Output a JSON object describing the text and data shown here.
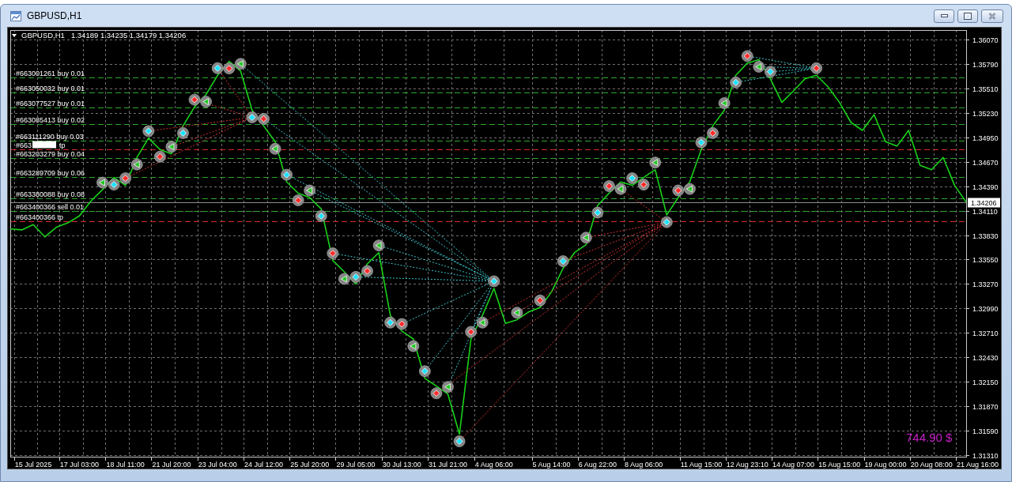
{
  "window": {
    "title": "GBPUSD,H1"
  },
  "chart": {
    "symbol": "GBPUSD,H1",
    "quote": "1.34189 1.34235 1.34179 1.34206",
    "profit": "744.90 $",
    "chart_data": {
      "type": "line",
      "grid": true,
      "categories": [
        null,
        null,
        "15 Jul 2025",
        null,
        null,
        null,
        "17 Jul 03:00",
        null,
        null,
        null,
        "18 Jul 11:00",
        null,
        null,
        null,
        "21 Jul 20:00",
        null,
        null,
        null,
        "23 Jul 04:00",
        null,
        null,
        null,
        "24 Jul 12:00",
        null,
        null,
        null,
        "25 Jul 20:00",
        null,
        null,
        null,
        "29 Jul 05:00",
        null,
        null,
        null,
        "30 Jul 13:00",
        null,
        null,
        null,
        "31 Jul 21:00",
        null,
        null,
        null,
        "4 Aug 06:00",
        null,
        null,
        null,
        null,
        "5 Aug 14:00",
        null,
        null,
        null,
        "6 Aug 22:00",
        null,
        null,
        null,
        "8 Aug 06:00",
        null,
        null,
        null,
        null,
        "11 Aug 15:00",
        null,
        null,
        null,
        "12 Aug 23:10",
        null,
        null,
        null,
        "14 Aug 07:00",
        null,
        null,
        null,
        "15 Aug 15:00",
        null,
        null,
        null,
        "19 Aug 00:00",
        null,
        null,
        null,
        "20 Aug 08:00",
        null,
        null,
        null,
        "21 Aug 16:00"
      ],
      "ylim": [
        1.31292,
        1.36179
      ],
      "yticks": [
        {
          "value": 1.3607,
          "label": "1.36070"
        },
        {
          "value": 1.3579,
          "label": "1.35790"
        },
        {
          "value": 1.3551,
          "label": "1.35510"
        },
        {
          "value": 1.3523,
          "label": "1.35230"
        },
        {
          "value": 1.3495,
          "label": "1.34950"
        },
        {
          "value": 1.3467,
          "label": "1.34670"
        },
        {
          "value": 1.3439,
          "label": "1.34390"
        },
        {
          "value": 1.3411,
          "label": "1.34110"
        },
        {
          "value": 1.3383,
          "label": "1.33830"
        },
        {
          "value": 1.3355,
          "label": "1.33550"
        },
        {
          "value": 1.3327,
          "label": "1.33270"
        },
        {
          "value": 1.3299,
          "label": "1.32990"
        },
        {
          "value": 1.3271,
          "label": "1.32710"
        },
        {
          "value": 1.3243,
          "label": "1.32430"
        },
        {
          "value": 1.3215,
          "label": "1.32150"
        },
        {
          "value": 1.3187,
          "label": "1.31870"
        },
        {
          "value": 1.3159,
          "label": "1.31590"
        },
        {
          "value": 1.3131,
          "label": "1.31310"
        }
      ],
      "series": [
        {
          "color": "#19d219",
          "values": [
            1.339,
            1.3389,
            1.3395,
            1.3381,
            1.3392,
            1.3397,
            1.3405,
            1.3422,
            1.3435,
            1.3449,
            1.344,
            1.3472,
            1.3494,
            1.3481,
            1.3476,
            1.3508,
            1.353,
            1.3544,
            1.3566,
            1.3582,
            1.3571,
            1.3526,
            1.3508,
            1.349,
            1.3444,
            1.3431,
            1.3426,
            1.3413,
            1.3354,
            1.3341,
            1.3327,
            1.335,
            1.3363,
            1.3291,
            1.3273,
            1.3264,
            1.3219,
            1.321,
            1.3201,
            1.3155,
            1.3264,
            1.3291,
            1.3322,
            1.3282,
            1.3286,
            1.3295,
            1.33,
            1.3318,
            1.3345,
            1.3363,
            1.3372,
            1.3417,
            1.3431,
            1.3444,
            1.344,
            1.3449,
            1.3458,
            1.3406,
            1.3426,
            1.3444,
            1.3481,
            1.3508,
            1.3526,
            1.3566,
            1.358,
            1.3584,
            1.3562,
            1.3535,
            1.3548,
            1.3562,
            1.3566,
            1.3553,
            1.3535,
            1.3512,
            1.3503,
            1.3521,
            1.349,
            1.3485,
            1.3503,
            1.3463,
            1.3458,
            1.3472,
            1.344,
            1.3421,
            null
          ]
        }
      ],
      "ref_lines": [
        {
          "axis": "y",
          "value": 1.3564,
          "color": "#2ca82c"
        },
        {
          "axis": "y",
          "value": 1.3546,
          "color": "#2ca82c"
        },
        {
          "axis": "y",
          "value": 1.3529,
          "color": "#2ca82c"
        },
        {
          "axis": "y",
          "value": 1.351,
          "color": "#2ca82c"
        },
        {
          "axis": "y",
          "value": 1.3491,
          "color": "#2ca82c"
        },
        {
          "axis": "y",
          "value": 1.3481,
          "color": "#d42a2a"
        },
        {
          "axis": "y",
          "value": 1.3471,
          "color": "#2ca82c"
        },
        {
          "axis": "y",
          "value": 1.345,
          "color": "#2ca82c"
        },
        {
          "axis": "y",
          "value": 1.3425,
          "color": "#2ca82c"
        },
        {
          "axis": "y",
          "value": 1.34206,
          "label": "1.34206",
          "color": "#8e8e8e"
        },
        {
          "axis": "y",
          "value": 1.3411,
          "color": "#2ca82c"
        },
        {
          "axis": "y",
          "value": 1.3399,
          "color": "#d42a2a"
        }
      ],
      "annotations": [
        {
          "y": 1.3564,
          "text": "#663001261 buy 0.01"
        },
        {
          "y": 1.3546,
          "text": "#663050032 buy 0.01"
        },
        {
          "y": 1.3529,
          "text": "#663077527 buy 0.01"
        },
        {
          "y": 1.351,
          "text": "#663085413 buy 0.02"
        },
        {
          "y": 1.3491,
          "text": "#663111290 buy 0.03"
        },
        {
          "y": 1.3481,
          "text": "#663"
        },
        {
          "y": 1.3481,
          "text": "tp"
        },
        {
          "y": 1.3471,
          "text": "#663203279 buy 0.04"
        },
        {
          "y": 1.345,
          "text": "#663289709 buy 0.06"
        },
        {
          "y": 1.3425,
          "text": "#663380088 buy 0.08"
        },
        {
          "y": 1.3411,
          "text": "#663400366 sell 0.01"
        },
        {
          "y": 1.3399,
          "text": "#663400366 tp"
        }
      ]
    }
  }
}
